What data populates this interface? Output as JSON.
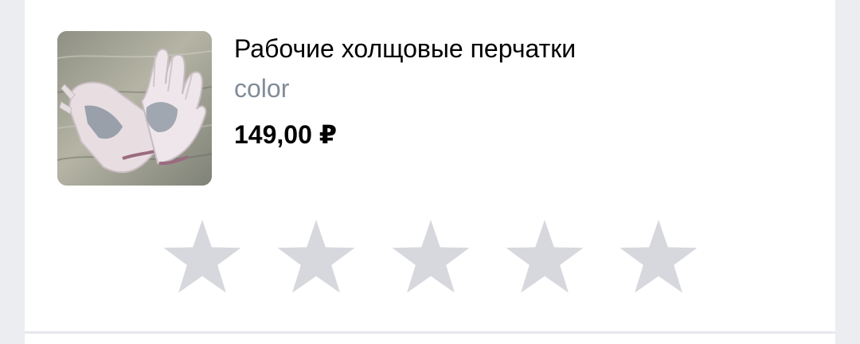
{
  "product": {
    "title": "Рабочие холщовые перчатки",
    "variant": "color",
    "price": "149,00 ₽",
    "image_icon": "work-gloves-photo"
  },
  "rating": {
    "value": 0,
    "max": 5,
    "empty_star_color": "#d7d8dd"
  }
}
